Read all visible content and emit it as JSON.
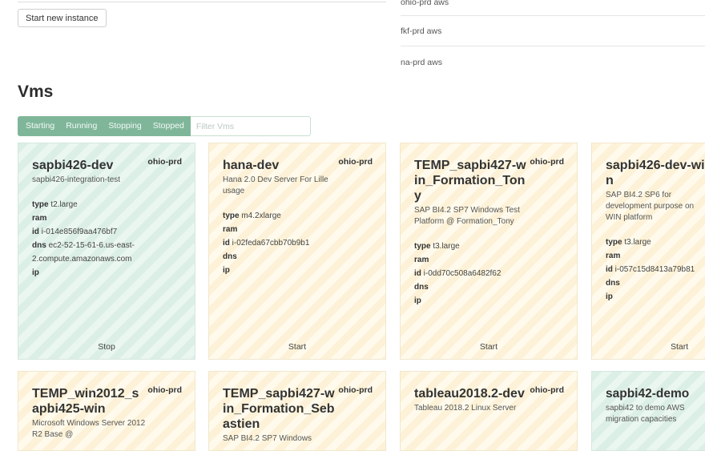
{
  "top": {
    "start_button": "Start new instance",
    "regions": [
      "ohio-prd aws",
      "fkf-prd aws",
      "na-prd aws"
    ]
  },
  "vms_section": {
    "title": "Vms",
    "state_filters": [
      "Starting",
      "Running",
      "Stopping",
      "Stopped"
    ],
    "filter_placeholder": "Filter Vms"
  },
  "cards": [
    {
      "name": "sapbi426-dev",
      "region": "ohio-prd",
      "description": "sapbi426-integration-test",
      "state": "running",
      "type": "t2.large",
      "ram": "",
      "id": "i-014e856f9aa476bf7",
      "dns": "ec2-52-15-61-6.us-east-2.compute.amazonaws.com",
      "ip": "",
      "action": "Stop"
    },
    {
      "name": "hana-dev",
      "region": "ohio-prd",
      "description": "Hana 2.0 Dev Server For Lille usage",
      "state": "stopped",
      "type": "m4.2xlarge",
      "ram": "",
      "id": "i-02feda67cbb70b9b1",
      "dns": "",
      "ip": "",
      "action": "Start"
    },
    {
      "name": "TEMP_sapbi427-win_Formation_Tony",
      "region": "ohio-prd",
      "description": "SAP BI4.2 SP7 Windows Test Platform @ Formation_Tony",
      "state": "stopped",
      "type": "t3.large",
      "ram": "",
      "id": "i-0dd70c508a6482f62",
      "dns": "",
      "ip": "",
      "action": "Start"
    },
    {
      "name": "sapbi426-dev-win",
      "region": "",
      "description": "SAP BI4.2 SP6 for development purpose on WIN platform",
      "state": "stopped",
      "type": "t3.large",
      "ram": "",
      "id": "i-057c15d8413a79b81",
      "dns": "",
      "ip": "",
      "action": "Start"
    },
    {
      "name": "TEMP_win2012_sapbi425-win",
      "region": "ohio-prd",
      "description": "Microsoft Windows Server 2012 R2 Base @",
      "state": "stopped"
    },
    {
      "name": "TEMP_sapbi427-win_Formation_Sebastien",
      "region": "ohio-prd",
      "description": "SAP BI4.2 SP7 Windows",
      "state": "stopped"
    },
    {
      "name": "tableau2018.2-dev",
      "region": "ohio-prd",
      "description": "Tableau 2018.2 Linux Server",
      "state": "stopped"
    },
    {
      "name": "sapbi42-demo",
      "region": "",
      "description": "sapbi42 to demo AWS migration capacities",
      "state": "running"
    }
  ],
  "labels": {
    "type": "type",
    "ram": "ram",
    "id": "id",
    "dns": "dns",
    "ip": "ip"
  },
  "colors": {
    "running_stripe": "#dcefe6",
    "stopped_stripe": "#fdf2d7",
    "filter_bar": "#7fb699"
  }
}
